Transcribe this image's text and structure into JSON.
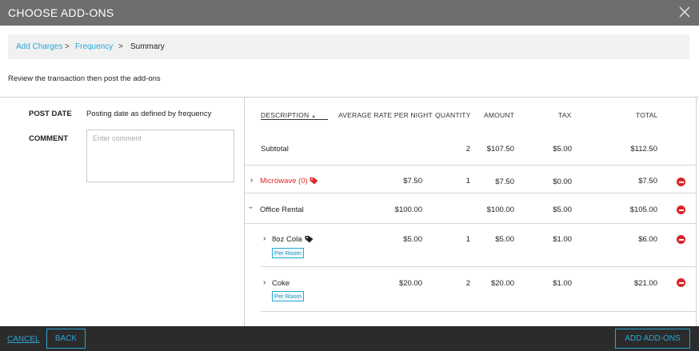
{
  "dialog": {
    "title": "CHOOSE ADD-ONS"
  },
  "breadcrumb": {
    "step1": "Add Charges",
    "sep": ">",
    "step2": "Frequency",
    "step3": "Summary"
  },
  "instructions": "Review the transaction then post the add-ons",
  "form": {
    "post_date_label": "POST DATE",
    "post_date_value": "Posting date as defined by frequency",
    "comment_label": "COMMENT",
    "comment_placeholder": "Enter comment"
  },
  "table": {
    "headers": {
      "description": "DESCRIPTION",
      "avg_rate": "AVERAGE RATE PER NIGHT",
      "quantity": "QUANTITY",
      "amount": "AMOUNT",
      "tax": "TAX",
      "total": "TOTAL"
    },
    "subtotal": {
      "label": "Subtotal",
      "quantity": "2",
      "amount": "$107.50",
      "tax": "$5.00",
      "total": "$112.50"
    },
    "rows": [
      {
        "description": "Microwave (0)",
        "rate": "$7.50",
        "quantity": "1",
        "amount": "$7.50",
        "tax": "$0.00",
        "total": "$7.50",
        "status_color": "#e0292a"
      },
      {
        "description": "Office Rental",
        "rate": "$100.00",
        "quantity": "",
        "amount": "$100.00",
        "tax": "$5.00",
        "total": "$105.00"
      },
      {
        "description": "8oz Cola",
        "rate": "$5.00",
        "quantity": "1",
        "amount": "$5.00",
        "tax": "$1.00",
        "total": "$6.00",
        "badge": "Per Room"
      },
      {
        "description": "Coke",
        "rate": "$20.00",
        "quantity": "2",
        "amount": "$20.00",
        "tax": "$1.00",
        "total": "$21.00",
        "badge": "Per Room"
      }
    ]
  },
  "footer": {
    "cancel": "CANCEL",
    "back": "BACK",
    "add": "ADD ADD-ONS"
  },
  "colors": {
    "accent": "#2aa7d6",
    "danger": "#e0292a",
    "titlebar": "#6e6e6e",
    "footer": "#2b2b2b"
  }
}
